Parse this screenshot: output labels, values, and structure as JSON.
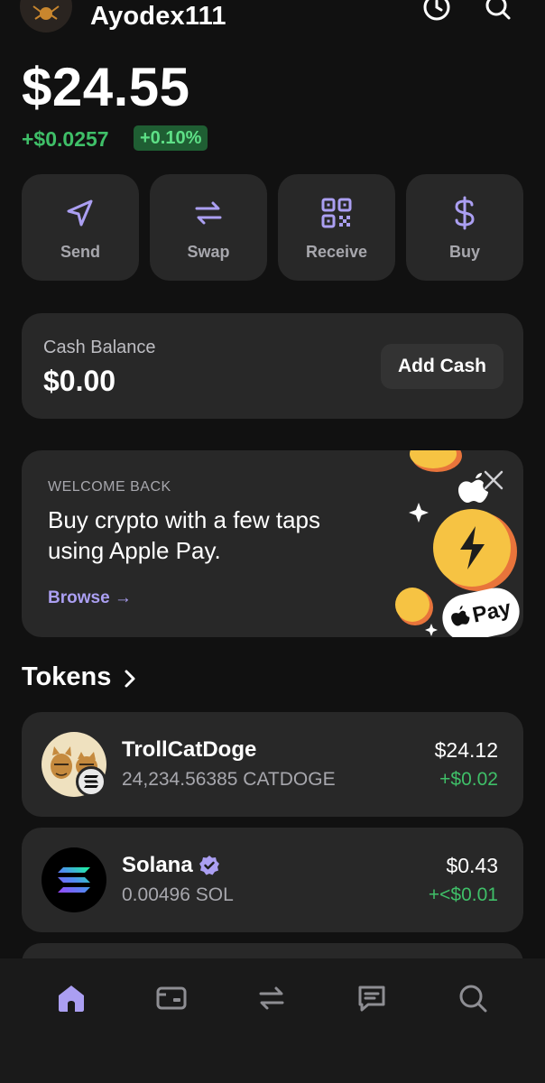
{
  "header": {
    "username": "Ayodex111",
    "icons": [
      "history-icon",
      "search-icon"
    ]
  },
  "portfolio": {
    "balance": "$24.55",
    "change": "+$0.0257",
    "change_pct": "+0.10%"
  },
  "actions": [
    {
      "label": "Send",
      "icon": "send-icon"
    },
    {
      "label": "Swap",
      "icon": "swap-icon"
    },
    {
      "label": "Receive",
      "icon": "qr-code-icon"
    },
    {
      "label": "Buy",
      "icon": "dollar-icon"
    }
  ],
  "cash": {
    "title": "Cash Balance",
    "value": "$0.00",
    "button": "Add Cash"
  },
  "promo": {
    "kicker": "WELCOME BACK",
    "text": "Buy crypto with a few taps using Apple Pay.",
    "link": "Browse →",
    "badge": "Pay"
  },
  "tokens": {
    "title": "Tokens",
    "items": [
      {
        "name": "TrollCatDoge",
        "amount": "24,234.56385 CATDOGE",
        "value": "$24.12",
        "change": "+$0.02"
      },
      {
        "name": "Solana",
        "amount": "0.00496 SOL",
        "value": "$0.43",
        "change": "+<$0.01",
        "verified": true
      }
    ]
  },
  "nav": {
    "items": [
      "home-icon",
      "wallet-card-icon",
      "swap-icon",
      "chat-icon",
      "search-icon"
    ],
    "active": "home-icon"
  },
  "colors": {
    "accent": "#ab9ff2",
    "positive": "#3fbf68",
    "card": "#282828",
    "background": "#111111"
  }
}
